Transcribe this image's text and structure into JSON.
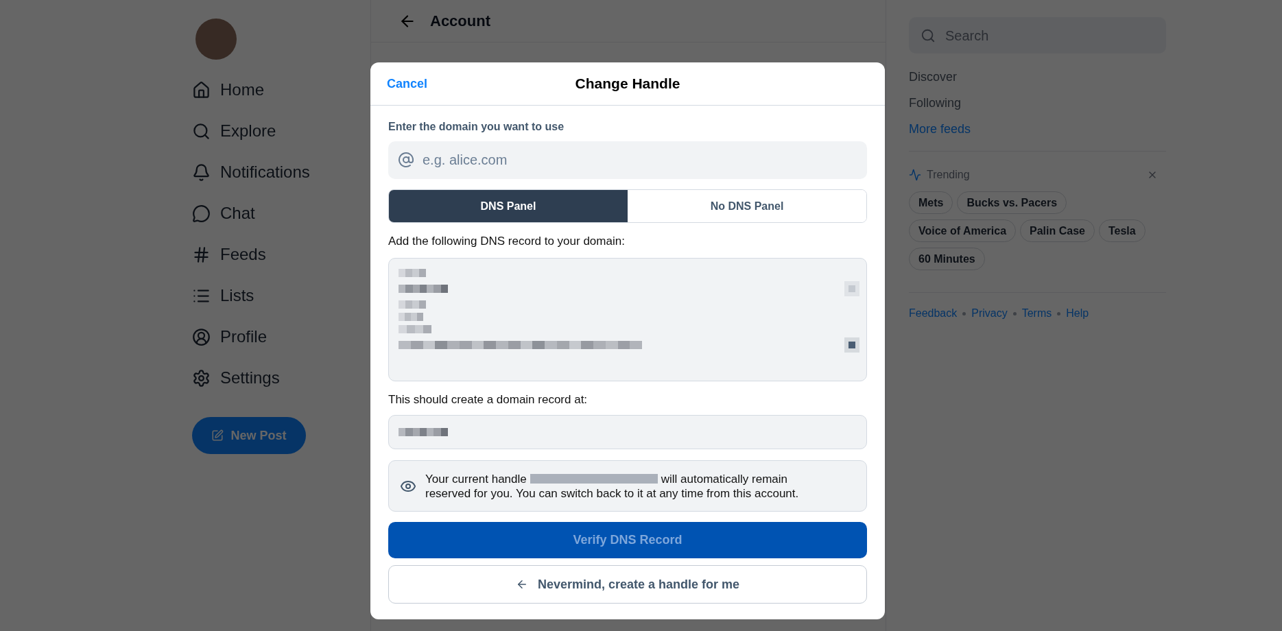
{
  "nav": [
    "Home",
    "Explore",
    "Notifications",
    "Chat",
    "Feeds",
    "Lists",
    "Profile",
    "Settings"
  ],
  "new_post": "New Post",
  "header": {
    "title": "Account"
  },
  "right": {
    "search_placeholder": "Search",
    "feeds": [
      {
        "label": "Discover",
        "kind": "feed"
      },
      {
        "label": "Following",
        "kind": "feed"
      },
      {
        "label": "More feeds",
        "kind": "link"
      }
    ],
    "trending_title": "Trending",
    "trending": [
      "Mets",
      "Bucks vs. Pacers",
      "Voice of America",
      "Palin Case",
      "Tesla",
      "60 Minutes"
    ],
    "footer": [
      "Feedback",
      "Privacy",
      "Terms",
      "Help"
    ]
  },
  "modal": {
    "cancel": "Cancel",
    "title": "Change Handle",
    "domain_label": "Enter the domain you want to use",
    "domain_placeholder": "e.g. alice.com",
    "tabs": [
      {
        "label": "DNS Panel",
        "selected": true
      },
      {
        "label": "No DNS Panel",
        "selected": false
      }
    ],
    "dns_label": "Add the following DNS record to your domain:",
    "record_label": "This should create a domain record at:",
    "info_before": "Your current handle",
    "info_after": "will automatically remain",
    "info_line2": "reserved for you. You can switch back to it at any time from this account.",
    "verify": {
      "label": "Verify DNS Record",
      "disabled": true
    },
    "nevermind": "Nevermind, create a handle for me"
  }
}
